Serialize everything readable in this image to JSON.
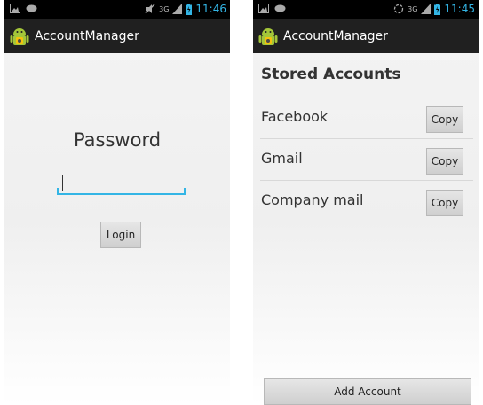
{
  "login_screen": {
    "status_bar": {
      "time": "11:46",
      "network": "3G"
    },
    "app_title": "AccountManager",
    "password_label": "Password",
    "password_value": "",
    "login_button": "Login"
  },
  "accounts_screen": {
    "status_bar": {
      "time": "11:45",
      "network": "3G"
    },
    "app_title": "AccountManager",
    "section_title": "Stored Accounts",
    "accounts": [
      {
        "name": "Facebook",
        "button": "Copy"
      },
      {
        "name": "Gmail",
        "button": "Copy"
      },
      {
        "name": "Company mail",
        "button": "Copy"
      }
    ],
    "add_button": "Add Account"
  },
  "colors": {
    "accent": "#33b5e5",
    "action_bar": "#202020",
    "status_bar": "#000000",
    "android_green": "#a4c639"
  }
}
